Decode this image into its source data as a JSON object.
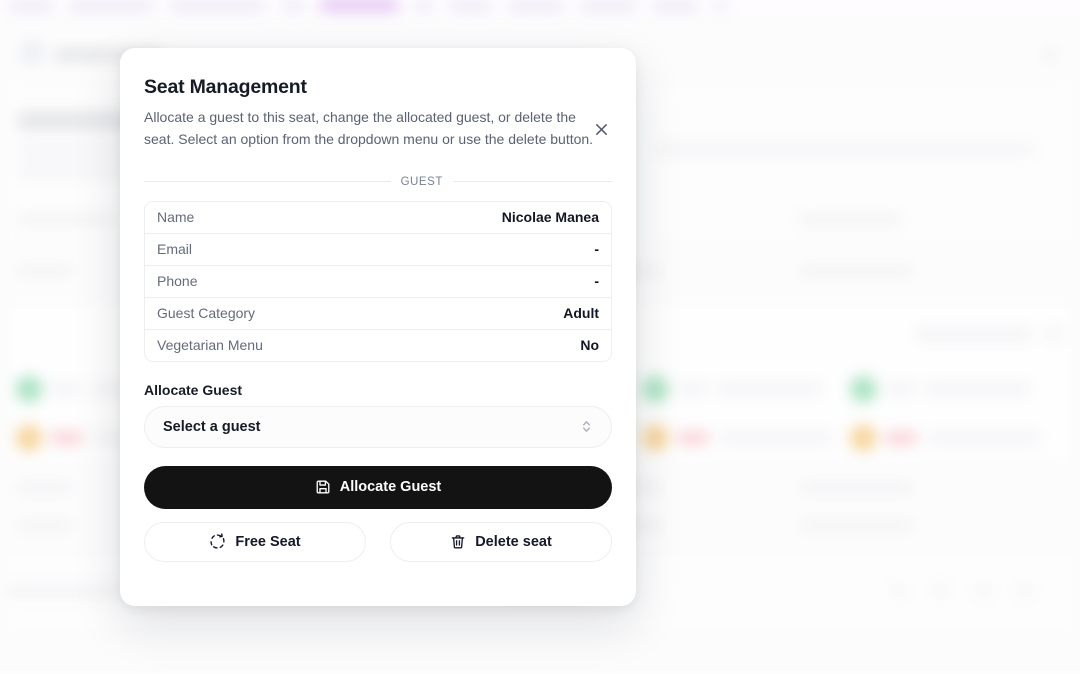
{
  "background": {
    "nav_pills": [
      {
        "width": 46,
        "style": "soft"
      },
      {
        "width": 84,
        "style": "soft"
      },
      {
        "width": 96,
        "style": "soft"
      },
      {
        "width": 24,
        "style": "soft"
      },
      {
        "width": 78,
        "style": "accent"
      },
      {
        "width": 20,
        "style": "soft"
      },
      {
        "width": 44,
        "style": "soft"
      },
      {
        "width": 56,
        "style": "soft"
      },
      {
        "width": 58,
        "style": "soft"
      },
      {
        "width": 46,
        "style": "soft"
      },
      {
        "width": 14,
        "style": "soft"
      }
    ],
    "avatar_colors": {
      "green": "#7fd5a4",
      "amber": "#f2c069",
      "red_chip": "#f7b6bd"
    }
  },
  "modal": {
    "title": "Seat Management",
    "description": "Allocate a guest to this seat, change the allocated guest, or delete the seat. Select an option from the dropdown menu or use the delete button.",
    "close_label": "×",
    "section_caption": "GUEST",
    "guest": {
      "rows": [
        {
          "label": "Name",
          "value": "Nicolae Manea"
        },
        {
          "label": "Email",
          "value": "-"
        },
        {
          "label": "Phone",
          "value": "-"
        },
        {
          "label": "Guest Category",
          "value": "Adult"
        },
        {
          "label": "Vegetarian Menu",
          "value": "No"
        }
      ]
    },
    "allocate": {
      "field_label": "Allocate Guest",
      "select_value": "Select a guest",
      "primary_button": "Allocate Guest"
    },
    "actions": {
      "free_seat": "Free Seat",
      "delete_seat": "Delete seat"
    },
    "colors": {
      "primary_button_bg": "#131313",
      "title": "#161b26",
      "body_text": "#5b6273",
      "border": "#eceef1"
    }
  }
}
